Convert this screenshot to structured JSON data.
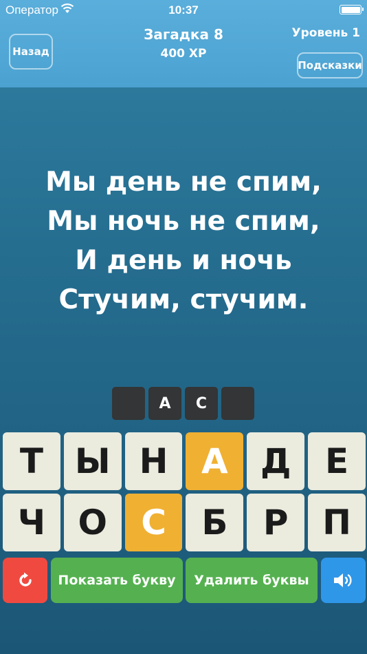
{
  "status_bar": {
    "carrier": "Оператор",
    "time": "10:37"
  },
  "header": {
    "back_label": "Назад",
    "riddle_title": "Загадка 8",
    "xp": "400 XP",
    "level": "Уровень 1",
    "hints_label": "Подсказки"
  },
  "riddle": {
    "lines": [
      "Мы день не спим,",
      "Мы ночь не спим,",
      "И день и ночь",
      "Стучим, стучим."
    ]
  },
  "answer_slots": [
    "",
    "А",
    "С",
    ""
  ],
  "letters": [
    [
      "Т",
      "Ы",
      "Н",
      "А",
      "Д",
      "Е"
    ],
    [
      "Ч",
      "О",
      "С",
      "Б",
      "Р",
      "П"
    ]
  ],
  "actions": {
    "reset_icon": "refresh-icon",
    "show_letter": "Показать букву",
    "remove_letters": "Удалить буквы",
    "sound_icon": "speaker-icon"
  },
  "colors": {
    "used_tile": "#f0b032",
    "reset": "#f04a40",
    "green": "#55b150",
    "sound": "#2f97e8"
  }
}
